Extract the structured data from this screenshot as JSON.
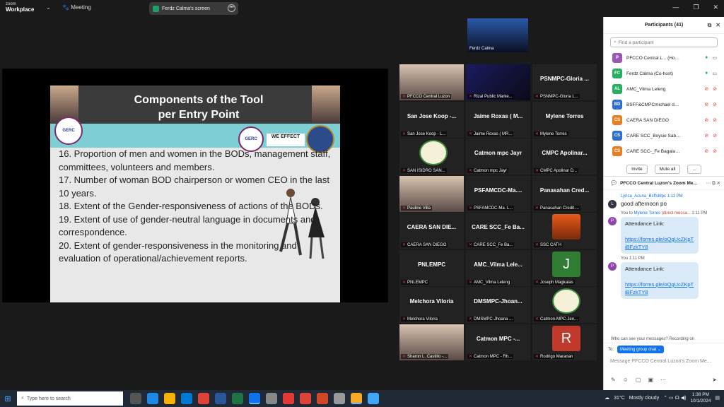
{
  "app": {
    "brand_small": "zoom",
    "brand": "Workplace",
    "menu_chevron": "chevron-down-icon",
    "meeting_label": "Meeting",
    "share_label": "Ferdz Calma's screen",
    "window_controls": [
      "—",
      "❐",
      "✕"
    ]
  },
  "slide": {
    "title_line1": "Components of the Tool",
    "title_line2": "per Entry Point",
    "logo_left": "GERC",
    "logo_mid": "GERC",
    "logo_we": "WE EFFECT",
    "items": [
      "16. Proportion of men and women in the BODs, management staff, committees, volunteers and members.",
      "17. Number of woman BOD chairperson or women CEO in the last 10 years.",
      "18. Extent of the  Gender-responsiveness of actions of the BODs.",
      "19. Extent of use of gender-neutral language in documents and correspondence.",
      "20. Extent of gender-responsiveness in the monitoring and evaluation of operational/achievement reports."
    ]
  },
  "speaker": {
    "label": "Ferdz Calma"
  },
  "tiles": [
    {
      "name": "",
      "label": "PFCCO Central Luzon",
      "video": "photo"
    },
    {
      "name": "",
      "label": "Rizal Public Marke...",
      "video": "dark"
    },
    {
      "name": "PSNMPC-Gloria ...",
      "label": "PSNMPC-Gloria L..."
    },
    {
      "name": "San Jose Koop -...",
      "label": "San Jose Koop - L..."
    },
    {
      "name": "Jaime Roxas ( M...",
      "label": "Jaime Roxas ( MR..."
    },
    {
      "name": "Mylene Torres",
      "label": "Mylene Torres"
    },
    {
      "name": "",
      "label": "SAN ISIDRO SAN...",
      "video": "logo"
    },
    {
      "name": "Catmon mpc Jayr",
      "label": "Catmon mpc Jayr"
    },
    {
      "name": "CMPC Apolinar...",
      "label": "CMPC Apolinar D..."
    },
    {
      "name": "",
      "label": "Pauline Villa",
      "video": "photo"
    },
    {
      "name": "PSFAMCDC-Ma....",
      "label": "PSFAMCDC-Ma. L..."
    },
    {
      "name": "Panasahan Cred...",
      "label": "Panasahan Credit-..."
    },
    {
      "name": "CAERA SAN DIE...",
      "label": "CAERA SAN DIEGO"
    },
    {
      "name": "CARE SCC_Fe Ba...",
      "label": "CARE SCC_Fe Ba..."
    },
    {
      "name": "",
      "label": "SSC CATH",
      "video": "orange"
    },
    {
      "name": "PNLEMPC",
      "label": "PNLEMPC"
    },
    {
      "name": "AMC_Vilma Lele...",
      "label": "AMC_Vilma Leleng"
    },
    {
      "name": "",
      "label": "Joseph Magkalas",
      "video": "J"
    },
    {
      "name": "Melchora Viloria",
      "label": "Melchora Viloria"
    },
    {
      "name": "DMSMPC-Jhoan...",
      "label": "DMSMPC-Jhoana ..."
    },
    {
      "name": "",
      "label": "Catmon-MPC-Jen...",
      "video": "logo"
    },
    {
      "name": "",
      "label": "Sharon L. Castillo -...",
      "video": "photo"
    },
    {
      "name": "Catmon MPC -...",
      "label": "Catmon MPC - Rh..."
    },
    {
      "name": "",
      "label": "Rodrigo Maranan",
      "video": "R"
    }
  ],
  "participants": {
    "title": "Participants (41)",
    "search_placeholder": "Find a participant",
    "rows": [
      {
        "initials": "P",
        "name": "PFCCO Central L... (Host, me)",
        "color": "#9b59b6"
      },
      {
        "initials": "FC",
        "name": "Ferdz Calma (Co-host)",
        "color": "#27ae60"
      },
      {
        "initials": "AL",
        "name": "AMC_Vilma Leleng",
        "color": "#27ae60"
      },
      {
        "initials": "BD",
        "name": "BSFF&CMPCmichael delariarte",
        "color": "#2e6fd1"
      },
      {
        "initials": "CS",
        "name": "CAERA SAN DIEGO",
        "color": "#e67e22"
      },
      {
        "initials": "CS",
        "name": "CARE SCC_Boysie Sabino",
        "color": "#2e6fd1"
      },
      {
        "initials": "CS",
        "name": "CARE SCC-_Fe Bagalawis",
        "color": "#e67e22"
      }
    ],
    "invite": "Invite",
    "mute_all": "Mute all",
    "more": "..."
  },
  "chat": {
    "title": "PFCCO Central Luzon's Zoom Me...",
    "msg1_meta": "Lyrica_Acuna_BsffsMpc  1:11 PM",
    "msg1_text": "good afternoon po",
    "msg2_meta_from": "You to ",
    "msg2_meta_to": "Mylene Torres",
    "msg2_meta_dm": "(direct messa...",
    "msg2_meta_time": "1:11 PM",
    "msg2_title": "Attendance Link:",
    "msg2_link": "https://forms.gle/oQgUcZKpTiBFzkTY8",
    "msg3_meta": "You  1:11 PM",
    "msg3_title": "Attendance Link:",
    "msg3_link": "https://forms.gle/oQgUcZKpTiBFzkTY8",
    "who_can_see": "Who can see your messages? Recording on",
    "to_label": "To:",
    "to_value": "Meeting group chat ⌄",
    "placeholder": "Message PFCCO Central Luzon's Zoom Me..."
  },
  "taskbar": {
    "search_placeholder": "Type here to search",
    "temperature": "31°C",
    "weather": "Mostly cloudy",
    "time": "1:38 PM",
    "date": "10/1/2024"
  },
  "colors": {
    "accent": "#0e72ed",
    "muted_red": "#e04040"
  }
}
